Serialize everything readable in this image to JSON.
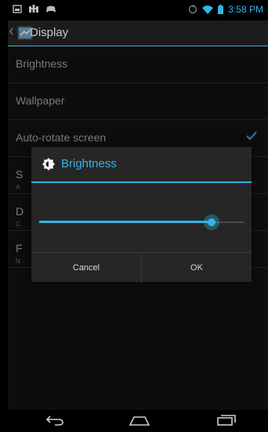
{
  "status_bar": {
    "time": "3:58 PM",
    "accent_color": "#33b5e5"
  },
  "action_bar": {
    "title": "Display"
  },
  "settings_list": {
    "items": [
      {
        "label": "Brightness",
        "subtext": ""
      },
      {
        "label": "Wallpaper",
        "subtext": ""
      },
      {
        "label": "Auto-rotate screen",
        "subtext": "",
        "checked": true
      },
      {
        "label": "S",
        "subtext": "A"
      },
      {
        "label": "D",
        "subtext": "C"
      },
      {
        "label": "F",
        "subtext": "N"
      }
    ]
  },
  "dialog": {
    "title": "Brightness",
    "title_icon": "brightness-icon",
    "slider_value": 0.84,
    "cancel_label": "Cancel",
    "ok_label": "OK"
  },
  "nav_bar": {
    "icons": [
      "back-icon",
      "home-icon",
      "recent-apps-icon"
    ]
  }
}
